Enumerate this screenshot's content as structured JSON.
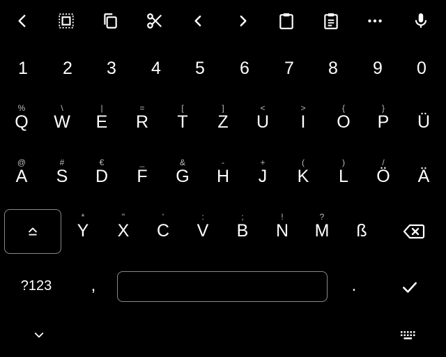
{
  "toolbar": {
    "icons": [
      "chevron-left",
      "select-all",
      "copy",
      "cut",
      "arrow-left",
      "arrow-right",
      "clipboard",
      "clipboard-list",
      "more",
      "microphone"
    ]
  },
  "number_row": [
    "1",
    "2",
    "3",
    "4",
    "5",
    "6",
    "7",
    "8",
    "9",
    "0"
  ],
  "row1": {
    "keys": [
      "Q",
      "W",
      "E",
      "R",
      "T",
      "Z",
      "U",
      "I",
      "O",
      "P",
      "Ü"
    ],
    "hints": [
      "%",
      "\\",
      "|",
      "=",
      "[",
      "]",
      "<",
      ">",
      "{",
      "}",
      ""
    ]
  },
  "row2": {
    "keys": [
      "A",
      "S",
      "D",
      "F",
      "G",
      "H",
      "J",
      "K",
      "L",
      "Ö",
      "Ä"
    ],
    "hints": [
      "@",
      "#",
      "€",
      "_",
      "&",
      "-",
      "+",
      "(",
      ")",
      "/",
      ""
    ]
  },
  "row3": {
    "keys": [
      "Y",
      "X",
      "C",
      "V",
      "B",
      "N",
      "M",
      "ß"
    ],
    "hints": [
      "*",
      "\"",
      "'",
      ":",
      ";",
      "!",
      "?",
      ""
    ]
  },
  "bottom": {
    "symbols_label": "?123",
    "comma": ",",
    "period": "."
  },
  "colors": {
    "background": "#000000",
    "foreground": "#ffffff",
    "hint": "#bdbdbd",
    "outline": "#8a8a8a"
  }
}
